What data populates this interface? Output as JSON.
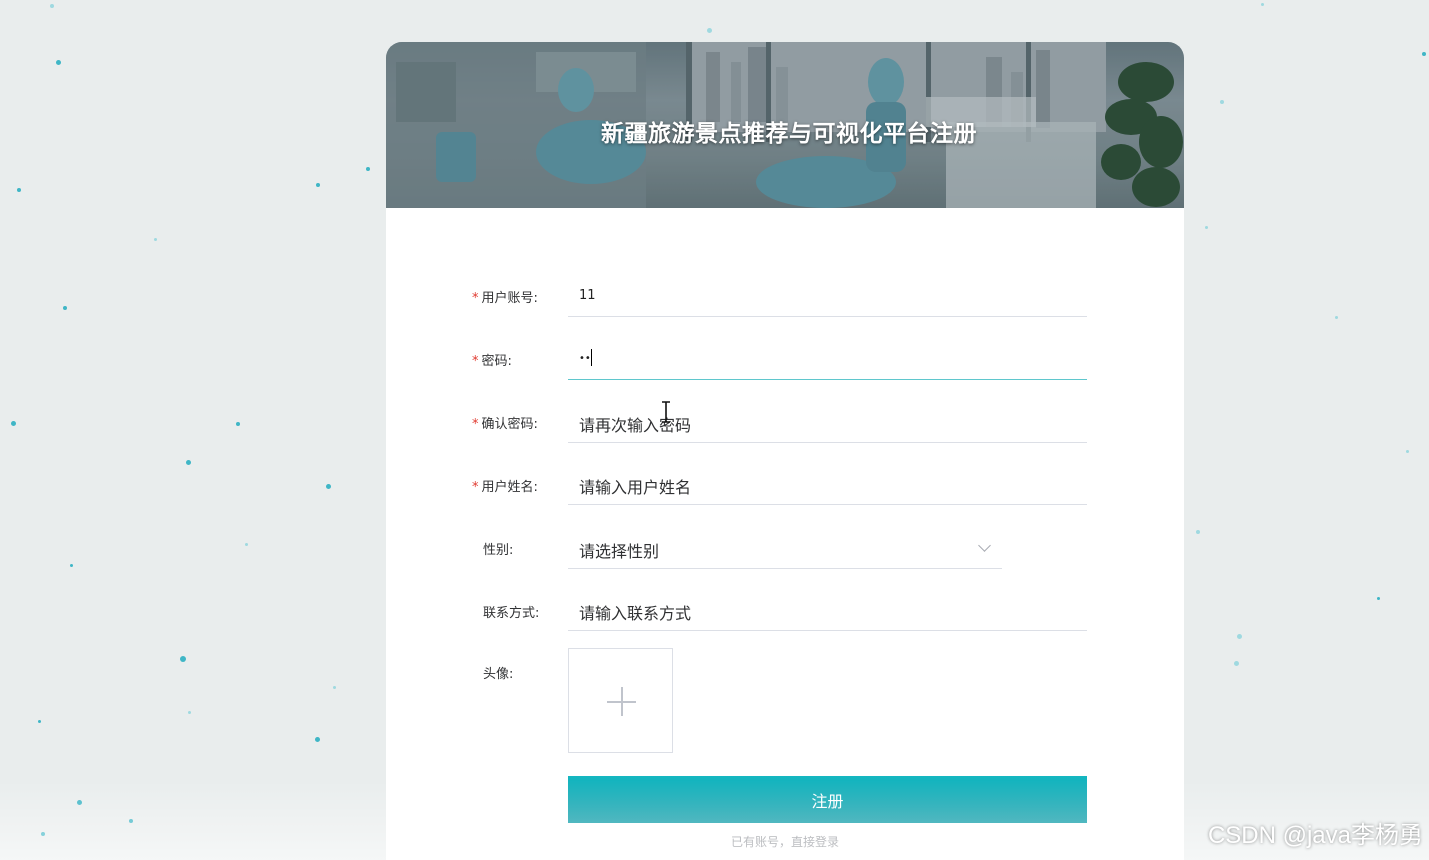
{
  "page": {
    "title": "新疆旅游景点推荐与可视化平台注册"
  },
  "form": {
    "account": {
      "label": "用户账号:",
      "value": "11",
      "required": true
    },
    "password": {
      "label": "密码:",
      "value": "••",
      "required": true,
      "focused": true
    },
    "confirm_password": {
      "label": "确认密码:",
      "placeholder": "请再次输入密码",
      "required": true
    },
    "username": {
      "label": "用户姓名:",
      "placeholder": "请输入用户姓名",
      "required": true
    },
    "gender": {
      "label": "性别:",
      "placeholder": "请选择性别",
      "required": false
    },
    "contact": {
      "label": "联系方式:",
      "placeholder": "请输入联系方式",
      "required": false
    },
    "avatar": {
      "label": "头像:",
      "required": false
    },
    "required_mark": "*",
    "submit_label": "注册",
    "login_link": "已有账号，直接登录"
  },
  "watermark": "CSDN @java李杨勇",
  "colors": {
    "accent": "#0fa9b4",
    "required": "#e0392f",
    "focus_border": "#5fc7cd",
    "background": "#e9eded"
  },
  "icons": {
    "gender_dropdown": "chevron-down-icon",
    "avatar_upload": "plus-icon"
  }
}
